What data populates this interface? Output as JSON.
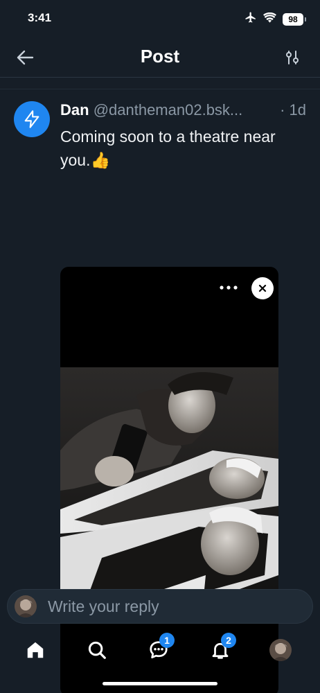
{
  "status_bar": {
    "time": "3:41",
    "battery": "98",
    "icons": [
      "airplane-icon",
      "wifi-icon",
      "battery-icon"
    ]
  },
  "header": {
    "title": "Post",
    "back_icon": "arrow-left-icon",
    "filter_icon": "sliders-icon"
  },
  "post": {
    "author_name": "Dan",
    "author_handle": "@dantheman02.bsk...",
    "time": "· 1d",
    "text": "Coming soon to a theatre near you.👍",
    "avatar_icon": "lightning-bolt-icon",
    "media": {
      "more_icon": "ellipsis-icon",
      "close_icon": "close-icon"
    }
  },
  "reply": {
    "placeholder": "Write your reply"
  },
  "tabs": [
    {
      "name": "home",
      "icon": "home-icon",
      "badge": ""
    },
    {
      "name": "search",
      "icon": "search-icon",
      "badge": ""
    },
    {
      "name": "chat",
      "icon": "chat-icon",
      "badge": "1"
    },
    {
      "name": "notifications",
      "icon": "bell-icon",
      "badge": "2"
    },
    {
      "name": "profile",
      "icon": "avatar",
      "badge": ""
    }
  ],
  "colors": {
    "background": "#161e27",
    "accent": "#1f86f0",
    "muted_text": "#8b98a5"
  }
}
